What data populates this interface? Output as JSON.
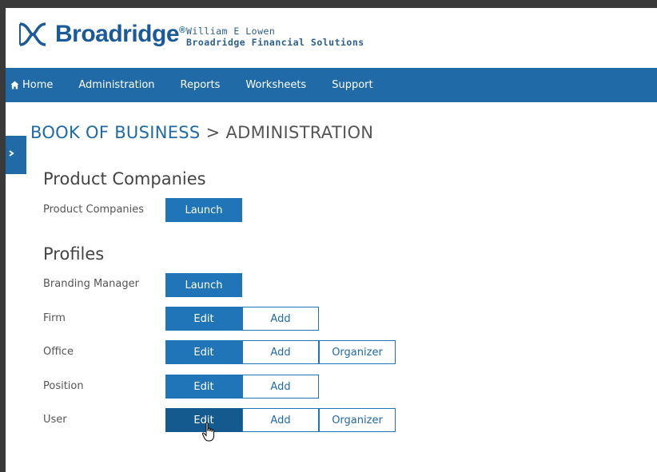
{
  "header": {
    "brand": "Broadridge",
    "brand_reg": "®",
    "user_name": "William E Lowen",
    "user_company": "Broadridge Financial Solutions"
  },
  "nav": {
    "items": [
      "Home",
      "Administration",
      "Reports",
      "Worksheets",
      "Support"
    ]
  },
  "breadcrumb": {
    "root": "BOOK OF BUSINESS",
    "separator": ">",
    "current": "ADMINISTRATION"
  },
  "sections": {
    "product_companies": {
      "title": "Product Companies",
      "rows": [
        {
          "label": "Product Companies",
          "buttons": [
            "Launch"
          ]
        }
      ]
    },
    "profiles": {
      "title": "Profiles",
      "rows": [
        {
          "label": "Branding Manager",
          "buttons": [
            "Launch"
          ]
        },
        {
          "label": "Firm",
          "buttons": [
            "Edit",
            "Add"
          ]
        },
        {
          "label": "Office",
          "buttons": [
            "Edit",
            "Add",
            "Organizer"
          ]
        },
        {
          "label": "Position",
          "buttons": [
            "Edit",
            "Add"
          ]
        },
        {
          "label": "User",
          "buttons": [
            "Edit",
            "Add",
            "Organizer"
          ]
        }
      ]
    }
  },
  "colors": {
    "brand_blue": "#1f6aa7",
    "button_blue": "#1f75b8",
    "button_hover": "#145a8e"
  },
  "icons": {
    "home": "home-icon",
    "sidebar_toggle": "chevron-right-icon",
    "cursor": "hand-pointer-icon"
  }
}
